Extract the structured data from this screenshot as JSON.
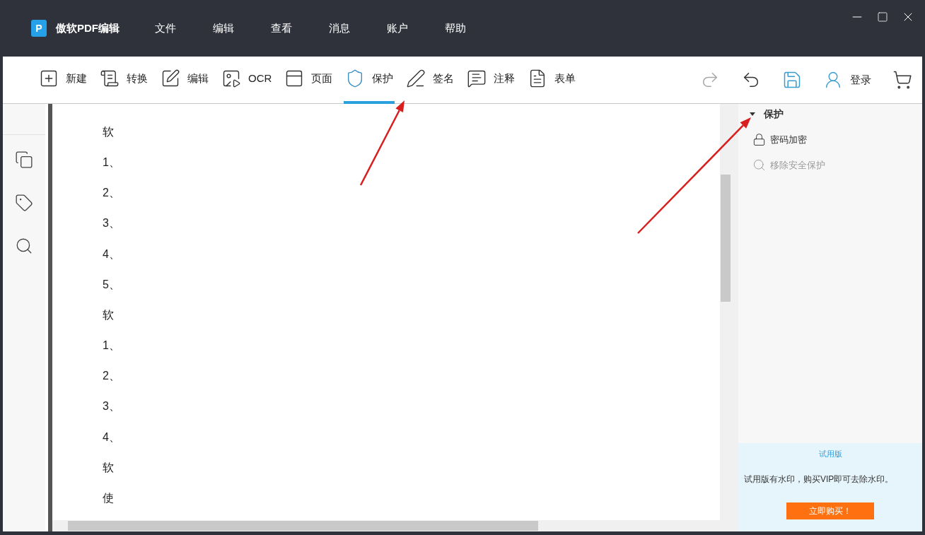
{
  "app": {
    "logo_letter": "P",
    "title": "傲软PDF编辑"
  },
  "menu": [
    "文件",
    "编辑",
    "查看",
    "消息",
    "账户",
    "帮助"
  ],
  "toolbar": [
    {
      "kind": "new",
      "label": "新建",
      "selected": false
    },
    {
      "kind": "convert",
      "label": "转换",
      "selected": false
    },
    {
      "kind": "edit",
      "label": "编辑",
      "selected": false
    },
    {
      "kind": "ocr",
      "label": "OCR",
      "selected": false
    },
    {
      "kind": "page",
      "label": "页面",
      "selected": false
    },
    {
      "kind": "protect",
      "label": "保护",
      "selected": true
    },
    {
      "kind": "sign",
      "label": "签名",
      "selected": false
    },
    {
      "kind": "comment",
      "label": "注释",
      "selected": false
    },
    {
      "kind": "form",
      "label": "表单",
      "selected": false
    }
  ],
  "actions": [
    {
      "kind": "redo",
      "disabled": true
    },
    {
      "kind": "undo",
      "disabled": false
    },
    {
      "kind": "save",
      "disabled": false
    },
    {
      "kind": "login",
      "label": "登录",
      "disabled": false
    },
    {
      "kind": "cart",
      "disabled": false
    }
  ],
  "sidebar": [
    {
      "kind": "pages"
    },
    {
      "kind": "tag"
    },
    {
      "kind": "search"
    }
  ],
  "document": {
    "lines": [
      "软",
      "1、",
      "2、",
      "3、",
      "4、",
      "5、",
      "软",
      "1、",
      "2、",
      "3、",
      "4、",
      "软",
      "使"
    ]
  },
  "panel": {
    "section": {
      "title": "保护",
      "expanded": true,
      "items": [
        {
          "kind": "lock",
          "label": "密码加密",
          "disabled": false
        },
        {
          "kind": "search",
          "label": "移除安全保护",
          "disabled": true
        }
      ]
    },
    "trial": {
      "title": "试用版",
      "text": "试用版有水印，购买VIP即可去除水印。",
      "button": "立即购买！"
    }
  },
  "annotations": [
    {
      "kind": "arrow"
    },
    {
      "kind": "arrow"
    }
  ]
}
